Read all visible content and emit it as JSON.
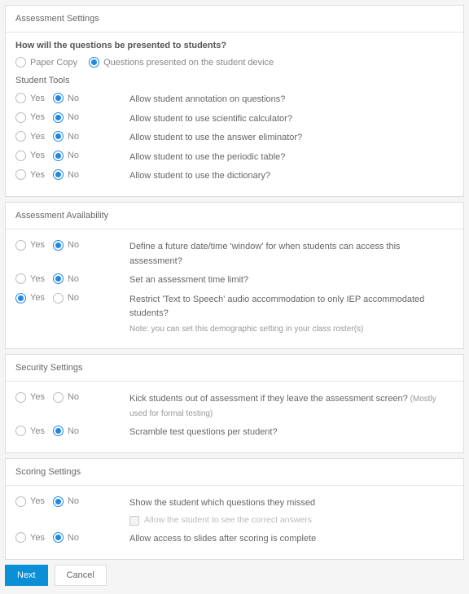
{
  "yesLabel": "Yes",
  "noLabel": "No",
  "panels": {
    "assessment": {
      "title": "Assessment Settings",
      "presentation": {
        "question": "How will the questions be presented to students?",
        "paperLabel": "Paper Copy",
        "deviceLabel": "Questions presented on the student device",
        "selected": "device"
      },
      "studentToolsHeading": "Student Tools",
      "tools": [
        {
          "label": "Allow student annotation on questions?",
          "value": "no"
        },
        {
          "label": "Allow student to use scientific calculator?",
          "value": "no"
        },
        {
          "label": "Allow student to use the answer eliminator?",
          "value": "no"
        },
        {
          "label": "Allow student to use the periodic table?",
          "value": "no"
        },
        {
          "label": "Allow student to use the dictionary?",
          "value": "no"
        }
      ]
    },
    "availability": {
      "title": "Assessment Availability",
      "rows": [
        {
          "label": "Define a future date/time 'window' for when students can access this assessment?",
          "value": "no"
        },
        {
          "label": "Set an assessment time limit?",
          "value": "no"
        },
        {
          "label": "Restrict 'Text to Speech' audio accommodation to only IEP accommodated students?",
          "value": "yes",
          "note": "Note: you can set this demographic setting in your class roster(s)"
        }
      ]
    },
    "security": {
      "title": "Security Settings",
      "rows": [
        {
          "label": "Kick students out of assessment if they leave the assessment screen?",
          "inlineNote": "(Mostly used for formal testing)",
          "value": "none"
        },
        {
          "label": "Scramble test questions per student?",
          "value": "no"
        }
      ]
    },
    "scoring": {
      "title": "Scoring Settings",
      "rows": [
        {
          "label": "Show the student which questions they missed",
          "value": "no",
          "subCheck": "Allow the student to see the correct answers"
        },
        {
          "label": "Allow access to slides after scoring is complete",
          "value": "no"
        }
      ]
    }
  },
  "buttons": {
    "next": "Next",
    "cancel": "Cancel"
  }
}
